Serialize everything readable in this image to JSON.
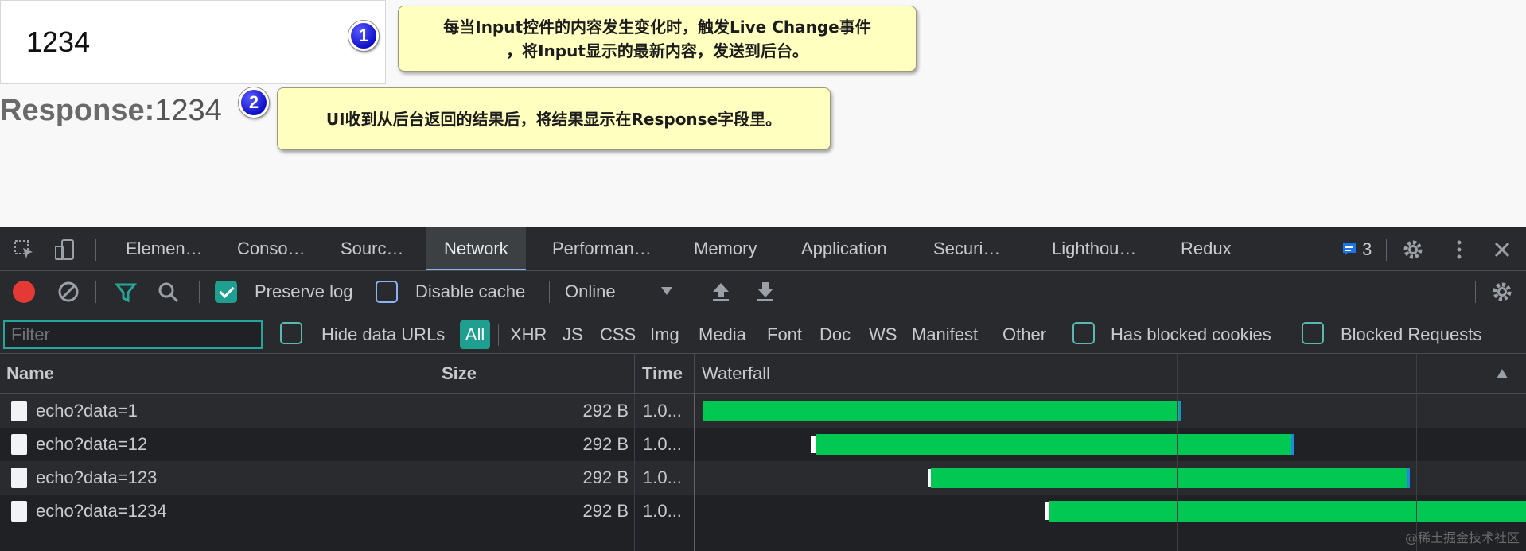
{
  "page": {
    "input_value": "1234",
    "response_label": "Response:",
    "response_value": "1234"
  },
  "callouts": [
    {
      "badge": "1",
      "text_line1": "每当Input控件的内容发生变化时，触发Live Change事件",
      "text_line2": "，将Input显示的最新内容，发送到后台。"
    },
    {
      "badge": "2",
      "text_line1": "UI收到从后台返回的结果后，将结果显示在Response字段里。"
    }
  ],
  "devtools": {
    "tabs": [
      "Elemen…",
      "Conso…",
      "Sourc…",
      "Network",
      "Performan…",
      "Memory",
      "Application",
      "Securi…",
      "Lighthou…",
      "Redux"
    ],
    "active_tab": "Network",
    "issues_count": "3",
    "toolbar": {
      "preserve_log": "Preserve log",
      "disable_cache": "Disable cache",
      "throttling": "Online"
    },
    "filterbar": {
      "filter_placeholder": "Filter",
      "hide_data_urls": "Hide data URLs",
      "types": [
        "All",
        "XHR",
        "JS",
        "CSS",
        "Img",
        "Media",
        "Font",
        "Doc",
        "WS",
        "Manifest",
        "Other"
      ],
      "active_type": "All",
      "has_blocked_cookies": "Has blocked cookies",
      "blocked_requests": "Blocked Requests"
    },
    "table": {
      "columns": [
        "Name",
        "Size",
        "Time",
        "Waterfall"
      ],
      "rows": [
        {
          "name": "echo?data=1",
          "size": "292 B",
          "time": "1.0..."
        },
        {
          "name": "echo?data=12",
          "size": "292 B",
          "time": "1.0..."
        },
        {
          "name": "echo?data=123",
          "size": "292 B",
          "time": "1.0..."
        },
        {
          "name": "echo?data=1234",
          "size": "292 B",
          "time": "1.0..."
        }
      ]
    }
  },
  "watermark": "@稀土掘金技术社区",
  "colors": {
    "accent_teal": "#1f9f8f",
    "waterfall_green": "#00c853",
    "record_red": "#e53935",
    "callout_yellow": "#ffffc0",
    "badge_blue": "#1010c8"
  },
  "icons": [
    "inspect-icon",
    "device-toggle-icon",
    "issues-icon",
    "settings-gear-icon",
    "kebab-menu-icon",
    "close-icon",
    "record-icon",
    "clear-icon",
    "filter-icon",
    "search-icon",
    "dropdown-caret-icon",
    "upload-icon",
    "download-icon",
    "file-icon",
    "sort-arrow-icon"
  ]
}
